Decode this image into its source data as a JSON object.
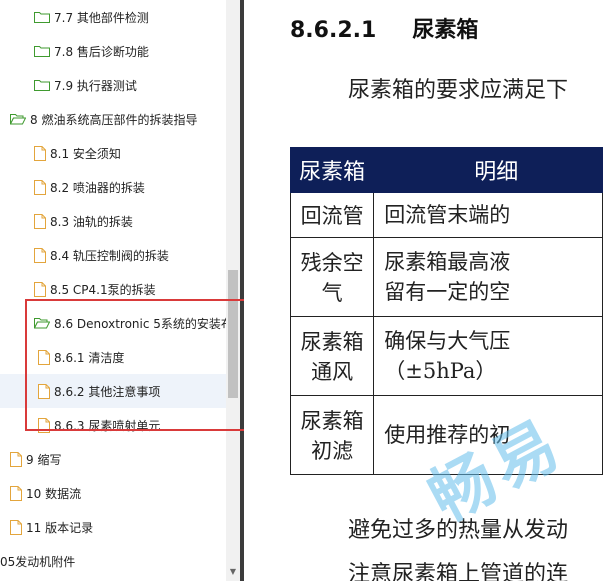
{
  "sidebar": {
    "items": [
      {
        "label": "7.7 其他部件检测",
        "icon": "folder-icon",
        "level": 2
      },
      {
        "label": "7.8 售后诊断功能",
        "icon": "folder-icon",
        "level": 2
      },
      {
        "label": "7.9 执行器测试",
        "icon": "folder-icon",
        "level": 2
      },
      {
        "label": "8 燃油系统高压部件的拆装指导",
        "icon": "folder-open-icon",
        "level": 1
      },
      {
        "label": "8.1 安全须知",
        "icon": "document-icon",
        "level": 2
      },
      {
        "label": "8.2 喷油器的拆装",
        "icon": "document-icon",
        "level": 2
      },
      {
        "label": "8.3 油轨的拆装",
        "icon": "document-icon",
        "level": 2
      },
      {
        "label": "8.4 轨压控制阀的拆装",
        "icon": "document-icon",
        "level": 2
      },
      {
        "label": "8.5 CP4.1泵的拆装",
        "icon": "document-icon",
        "level": 2
      },
      {
        "label": "8.6 Denoxtronic 5系统的安装布",
        "icon": "folder-open-icon",
        "level": 2
      },
      {
        "label": "8.6.1 清洁度",
        "icon": "document-icon",
        "level": 3
      },
      {
        "label": "8.6.2 其他注意事项",
        "icon": "document-icon",
        "level": 3
      },
      {
        "label": "8.6.3 尿素喷射单元",
        "icon": "document-icon",
        "level": 3
      },
      {
        "label": "9 缩写",
        "icon": "document-icon",
        "level": 1
      },
      {
        "label": "10 数据流",
        "icon": "document-icon",
        "level": 1
      },
      {
        "label": "11 版本记录",
        "icon": "document-icon",
        "level": 1
      },
      {
        "label": "05发动机附件",
        "icon": "none",
        "level": 0
      }
    ],
    "selected_index": 11
  },
  "doc": {
    "heading_number": "8.6.2.1",
    "heading_title": "尿素箱",
    "intro": "尿素箱的要求应满足下",
    "table": {
      "headers": [
        "尿素箱",
        "明细"
      ],
      "rows": [
        [
          "回流管",
          "回流管末端的"
        ],
        [
          "残余空气",
          "尿素箱最高液\n留有一定的空"
        ],
        [
          "尿素箱通风",
          "确保与大气压\n（±5hPa）"
        ],
        [
          "尿素箱初滤",
          "使用推荐的初"
        ]
      ]
    },
    "tail_lines": [
      "避免过多的热量从发动",
      "注意尿素箱上管道的连"
    ],
    "watermark": "畅易"
  },
  "colors": {
    "table_header_bg": "#0e1f58",
    "highlight_border": "#d93a3a",
    "folder_green": "#3f9a2f",
    "document_orange": "#e3a53c"
  }
}
